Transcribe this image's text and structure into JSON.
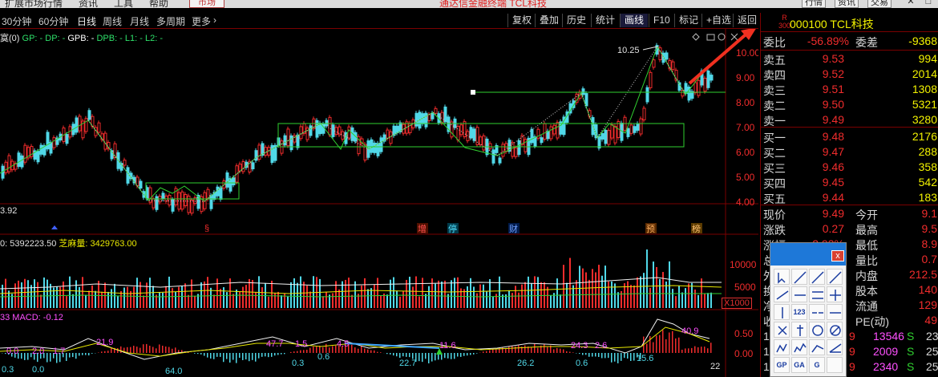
{
  "menu": {
    "items": [
      "扩展市场行情",
      "资讯",
      "工具",
      "帮助"
    ],
    "market": "市场",
    "title": "通达信金融终端  TCL科技",
    "buttons": [
      "行情",
      "资讯",
      "交易"
    ],
    "close": "✕"
  },
  "toolbar": {
    "periods": [
      "30分钟",
      "60分钟",
      "日线",
      "周线",
      "月线",
      "多周期",
      "更多"
    ],
    "active_period": "日线",
    "more_arrow": "›",
    "buttons": [
      "复权",
      "叠加",
      "历史",
      "统计",
      "画线",
      "F10",
      "标记",
      "+自选",
      "返回"
    ],
    "highlighted": "画线"
  },
  "indicators": {
    "label": "寞(0)",
    "items": [
      "GP: -",
      "DP: -",
      "GPB: -",
      "DPB: -",
      "L1: -",
      "L2: -"
    ],
    "icons": [
      "diamond-icon",
      "lock-icon",
      "settings-icon",
      "close-icon"
    ]
  },
  "volume": {
    "label": "0: 5392223.50",
    "series": "芝麻量: 3429763.00",
    "unit": "X1000",
    "axis": [
      "10000",
      "5000"
    ]
  },
  "macd": {
    "label": "33  MACD: -0.12",
    "axis": [
      "0.50",
      "0.00"
    ]
  },
  "price_axis": [
    "10.00",
    "9.00",
    "8.00",
    "7.00",
    "6.00",
    "5.00",
    "4.00"
  ],
  "chart_text": {
    "high_label": "10.25",
    "low_label": "3.92",
    "events": [
      "增",
      "停",
      "财",
      "预",
      "榜"
    ],
    "macd_labels": [
      "0.0",
      "2.0",
      "1.7",
      "21.9",
      "47.7",
      "1.5",
      "4.5",
      "11.6",
      "24.3",
      "2.6",
      "40.9"
    ],
    "bottom_labels": [
      "0.3",
      "0.0",
      "64.0",
      "0.3",
      "0.6",
      "22.7",
      "26.2",
      "0.6",
      "15.6",
      "22"
    ]
  },
  "quote": {
    "code_mark": "R",
    "code_sub": "300",
    "name": "000100 TCL科技",
    "weibi": {
      "label": "委比",
      "value": "-56.89%",
      "label2": "委差",
      "value2": "-9368"
    },
    "asks": [
      {
        "label": "卖五",
        "price": "9.53",
        "vol": "994"
      },
      {
        "label": "卖四",
        "price": "9.52",
        "vol": "2014"
      },
      {
        "label": "卖三",
        "price": "9.51",
        "vol": "1308"
      },
      {
        "label": "卖二",
        "price": "9.50",
        "vol": "5321"
      },
      {
        "label": "卖一",
        "price": "9.49",
        "vol": "3280"
      }
    ],
    "bids": [
      {
        "label": "买一",
        "price": "9.48",
        "vol": "2176"
      },
      {
        "label": "买二",
        "price": "9.47",
        "vol": "288"
      },
      {
        "label": "买三",
        "price": "9.46",
        "vol": "358"
      },
      {
        "label": "买四",
        "price": "9.45",
        "vol": "542"
      },
      {
        "label": "买五",
        "price": "9.44",
        "vol": "183"
      }
    ],
    "stats": [
      {
        "label": "现价",
        "value": "9.49",
        "label2": "今开",
        "value2": "9.1"
      },
      {
        "label": "涨跌",
        "value": "0.27",
        "label2": "最高",
        "value2": "9.5"
      },
      {
        "label": "涨幅",
        "value": "2.93%",
        "label2": "最低",
        "value2": "8.9"
      },
      {
        "label": "总量",
        "value": "",
        "label2": "量比",
        "value2": "0.7"
      },
      {
        "label": "外盘",
        "value": "",
        "label2": "内盘",
        "value2": "212.5"
      },
      {
        "label": "换手",
        "value": "%",
        "label2": "股本",
        "value2": "140"
      },
      {
        "label": "净资",
        "value": "30",
        "label2": "流通",
        "value2": "129"
      },
      {
        "label": "收益",
        "value": "50",
        "label2": "PE(动)",
        "value2": "49"
      }
    ],
    "ticks": [
      {
        "t": "14",
        "p": "9",
        "v": "13546",
        "s": "S",
        "n": "23"
      },
      {
        "t": "14",
        "p": "9",
        "v": "2009",
        "s": "S",
        "n": "25"
      },
      {
        "t": "14",
        "p": "9",
        "v": "2340",
        "s": "S",
        "n": "25"
      }
    ]
  },
  "palette": {
    "close": "x",
    "text_tools": [
      "123",
      "GP",
      "GA",
      "G"
    ]
  },
  "colors": {
    "up": "#f02c2c",
    "down": "#50d8e8",
    "panel_border": "#7a0000",
    "quote_yellow": "#f2f200",
    "trend_green": "#30d030"
  }
}
